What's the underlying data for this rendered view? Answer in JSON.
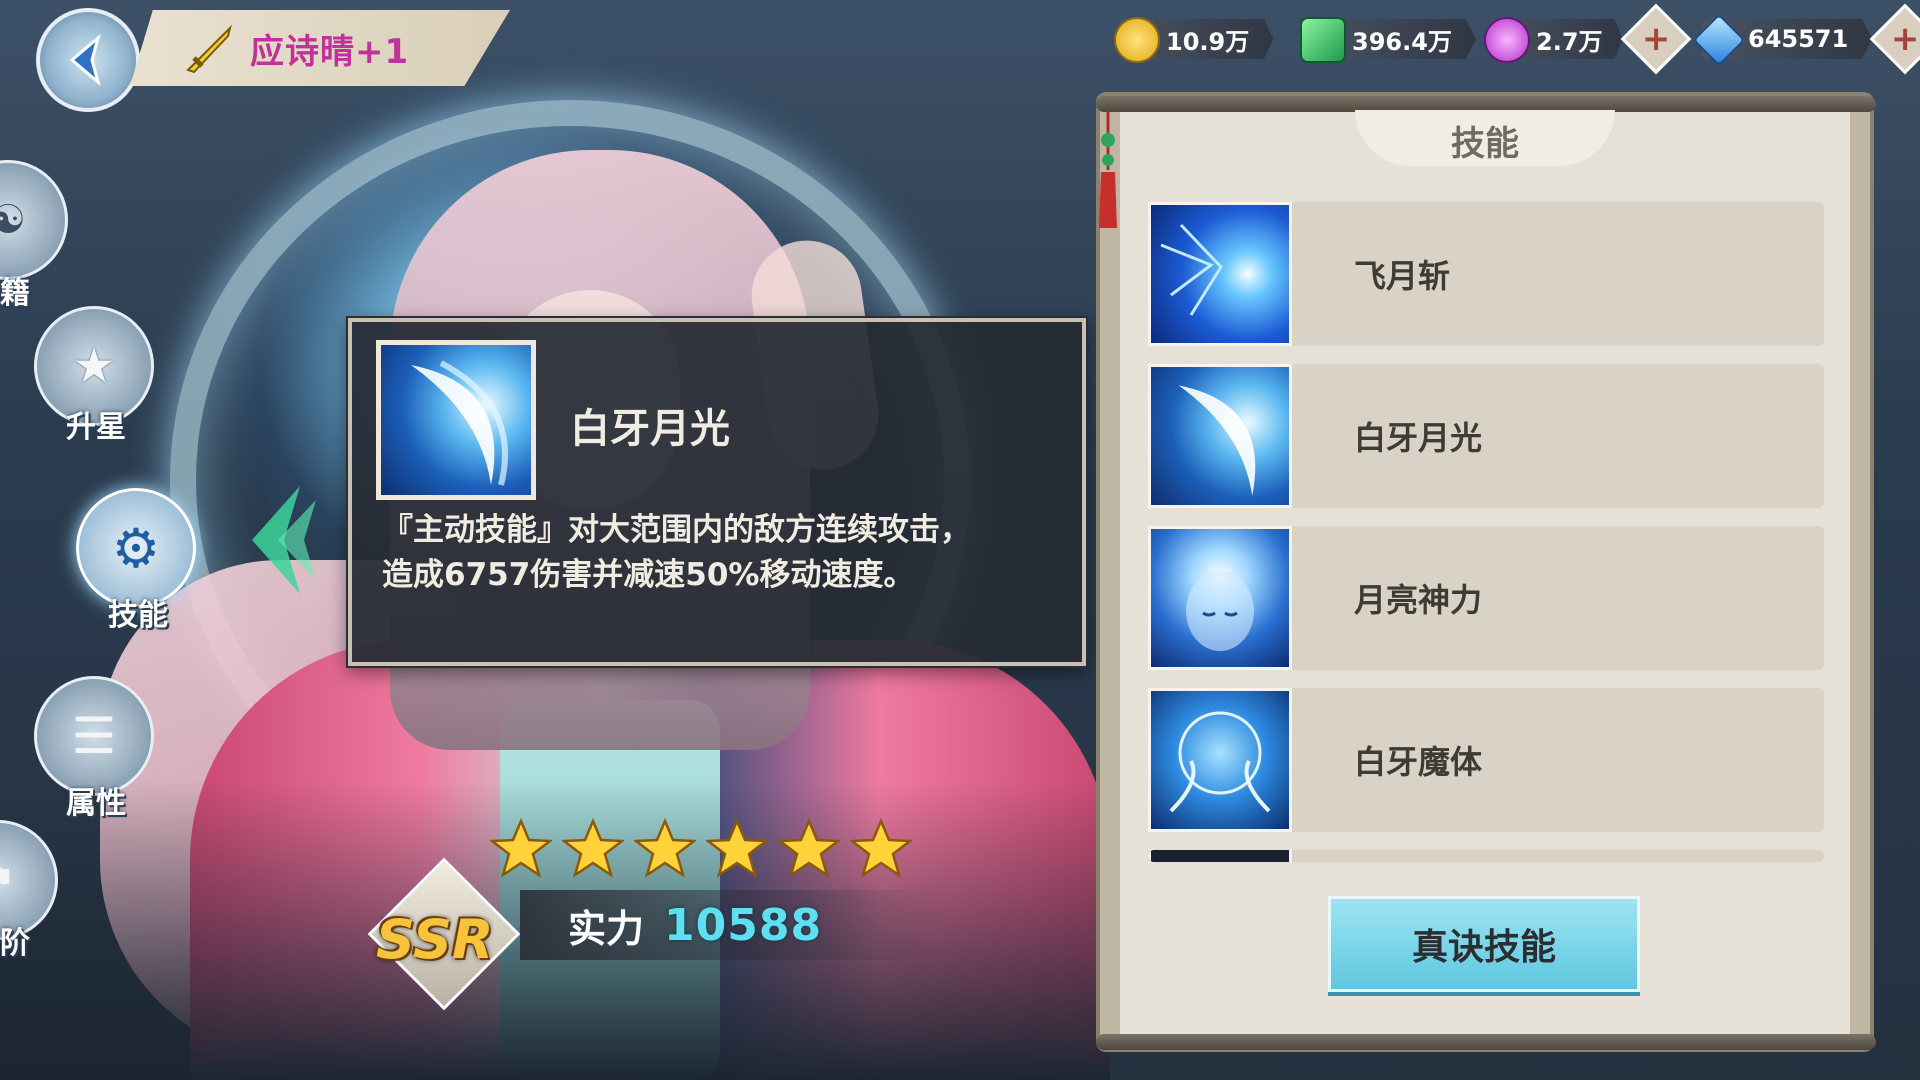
{
  "header": {
    "character_name": "应诗晴+1"
  },
  "currencies": [
    {
      "icon": "gold-coin-icon",
      "value": "10.9万",
      "color": "#f2c12e"
    },
    {
      "icon": "green-gem-icon",
      "value": "396.4万",
      "color": "#3cc26a"
    },
    {
      "icon": "purple-orb-icon",
      "value": "2.7万",
      "color": "#c94fd8"
    },
    {
      "icon": "diamond-icon",
      "value": "645571",
      "color": "#3e9ef2"
    }
  ],
  "side_menu": [
    {
      "label": "籍",
      "icon": "book-icon"
    },
    {
      "label": "升星",
      "icon": "star-icon"
    },
    {
      "label": "技能",
      "icon": "skill-icon"
    },
    {
      "label": "属性",
      "icon": "attributes-icon"
    },
    {
      "label": "阶",
      "icon": "rank-icon"
    }
  ],
  "tooltip": {
    "skill_name": "白牙月光",
    "desc_line1": "『主动技能』对大范围内的敌方连续攻击，",
    "desc_line2": "造成6757伤害并减速50%移动速度。"
  },
  "hero": {
    "stars": 6,
    "rarity": "SSR",
    "power_label": "实力",
    "power_value": "10588"
  },
  "skill_panel": {
    "title": "技能",
    "skills": [
      {
        "name": "飞月斩"
      },
      {
        "name": "白牙月光"
      },
      {
        "name": "月亮神力"
      },
      {
        "name": "白牙魔体"
      }
    ],
    "button_label": "真诀技能"
  }
}
